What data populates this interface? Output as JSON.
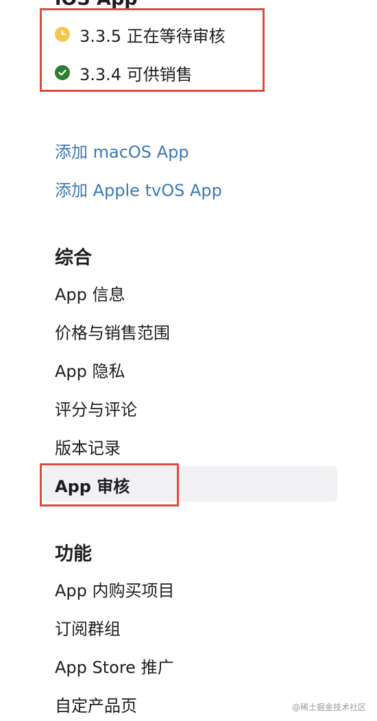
{
  "ios_section": {
    "title": "iOS App",
    "versions": [
      {
        "version_label": "3.3.5 正在等待审核",
        "status": "pending",
        "status_color": "#f2c94c"
      },
      {
        "version_label": "3.3.4 可供销售",
        "status": "ready_for_sale",
        "status_color": "#2e7d32"
      }
    ]
  },
  "platform_links": [
    {
      "label": "添加 macOS App"
    },
    {
      "label": "添加 Apple tvOS App"
    }
  ],
  "general_section": {
    "title": "综合",
    "items": [
      {
        "label": "App 信息"
      },
      {
        "label": "价格与销售范围"
      },
      {
        "label": "App 隐私"
      },
      {
        "label": "评分与评论"
      },
      {
        "label": "版本记录"
      },
      {
        "label": "App 审核"
      }
    ],
    "selected_index": 5
  },
  "features_section": {
    "title": "功能",
    "items": [
      {
        "label": "App 内购买项目"
      },
      {
        "label": "订阅群组"
      },
      {
        "label": "App Store 推广"
      },
      {
        "label": "自定产品页"
      }
    ]
  },
  "colors": {
    "link": "#3a78b9",
    "highlight_border": "#e0483a",
    "selected_background": "#f1f1f3"
  },
  "watermark": "@稀土掘金技术社区"
}
